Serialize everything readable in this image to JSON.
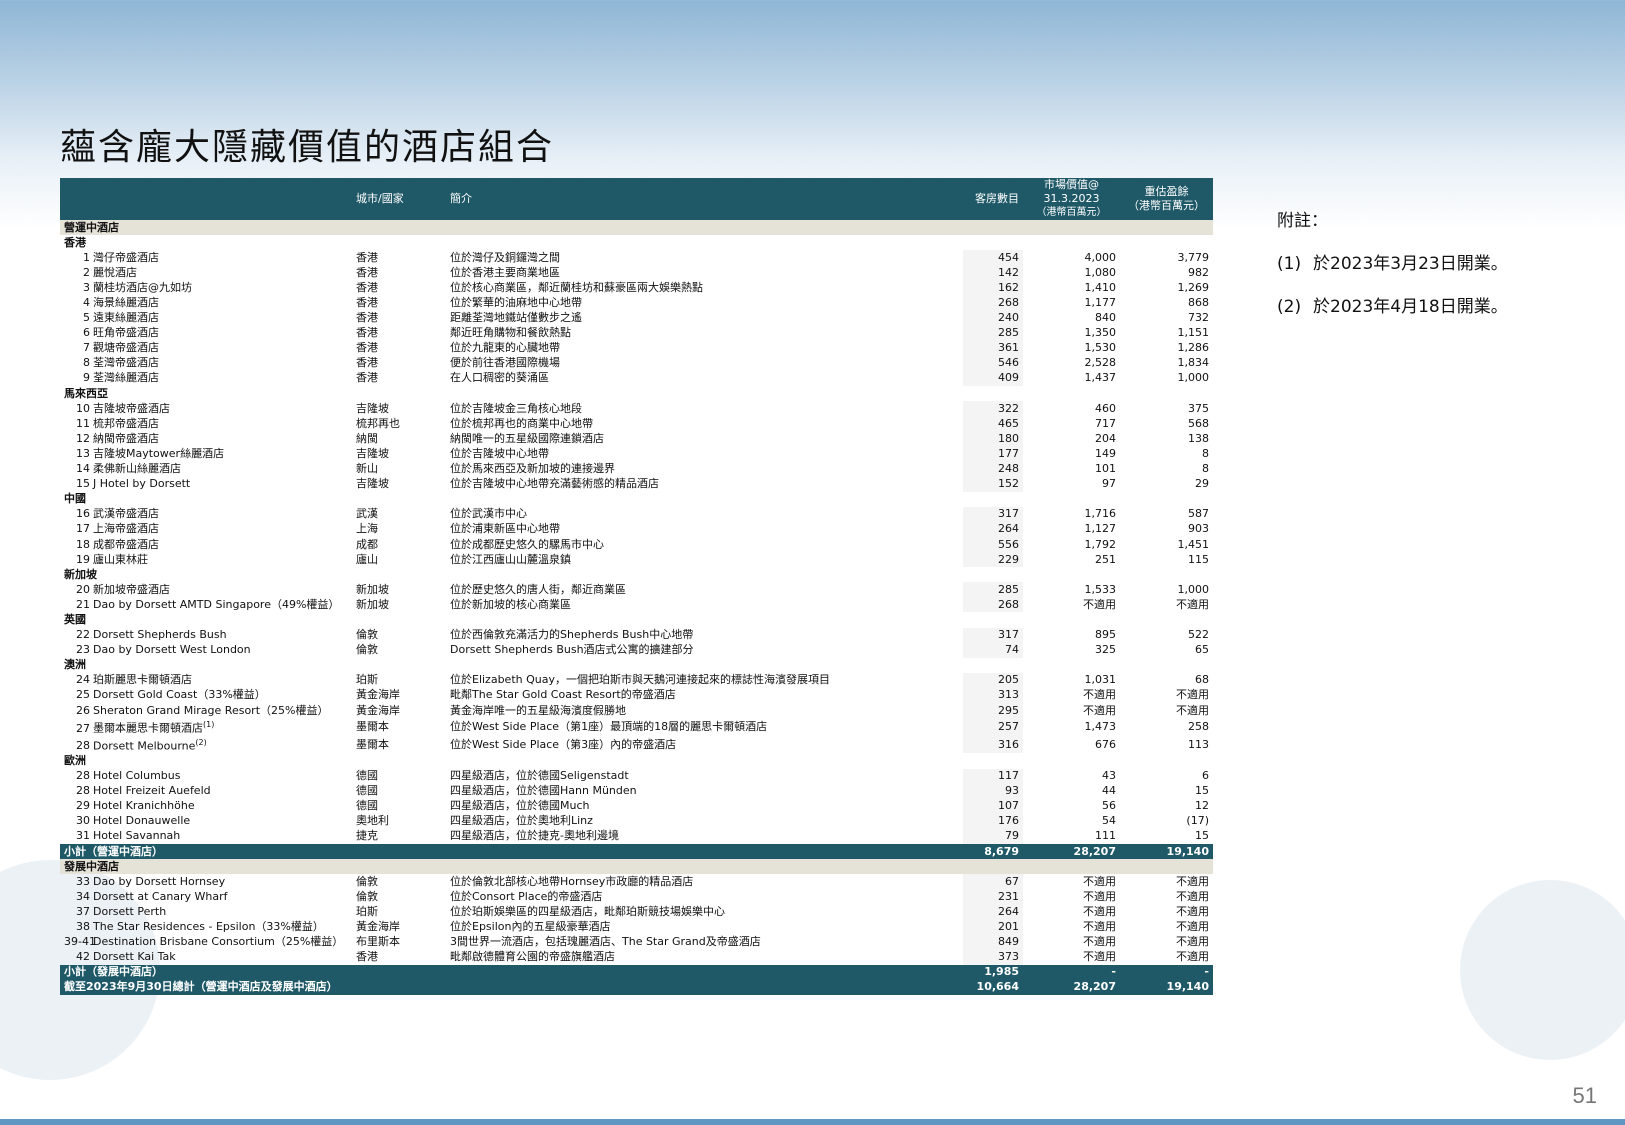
{
  "title": "蘊含龐大隱藏價值的酒店組合",
  "headers": {
    "city": "城市/國家",
    "desc": "簡介",
    "rooms": "客房數目",
    "value_line1": "市場價值@",
    "value_line2": "31.3.2023",
    "value_line3": "（港幣百萬元）",
    "surplus_line1": "重估盈餘",
    "surplus_line2": "（港幣百萬元）"
  },
  "sections": [
    {
      "label": "營運中酒店",
      "groups": [
        {
          "label": "香港",
          "rows": [
            {
              "no": "1",
              "name": "灣仔帝盛酒店",
              "city": "香港",
              "desc": "位於灣仔及銅鑼灣之間",
              "rooms": "454",
              "value": "4,000",
              "surplus": "3,779"
            },
            {
              "no": "2",
              "name": "麗悅酒店",
              "city": "香港",
              "desc": "位於香港主要商業地區",
              "rooms": "142",
              "value": "1,080",
              "surplus": "982"
            },
            {
              "no": "3",
              "name": "蘭桂坊酒店@九如坊",
              "city": "香港",
              "desc": "位於核心商業區，鄰近蘭桂坊和蘇豪區兩大娛樂熱點",
              "rooms": "162",
              "value": "1,410",
              "surplus": "1,269"
            },
            {
              "no": "4",
              "name": "海景絲麗酒店",
              "city": "香港",
              "desc": "位於繁華的油麻地中心地帶",
              "rooms": "268",
              "value": "1,177",
              "surplus": "868"
            },
            {
              "no": "5",
              "name": "遠東絲麗酒店",
              "city": "香港",
              "desc": "距離荃灣地鐵站僅數步之遙",
              "rooms": "240",
              "value": "840",
              "surplus": "732"
            },
            {
              "no": "6",
              "name": "旺角帝盛酒店",
              "city": "香港",
              "desc": "鄰近旺角購物和餐飲熱點",
              "rooms": "285",
              "value": "1,350",
              "surplus": "1,151"
            },
            {
              "no": "7",
              "name": "觀塘帝盛酒店",
              "city": "香港",
              "desc": "位於九龍東的心臟地帶",
              "rooms": "361",
              "value": "1,530",
              "surplus": "1,286"
            },
            {
              "no": "8",
              "name": "荃灣帝盛酒店",
              "city": "香港",
              "desc": "便於前往香港國際機場",
              "rooms": "546",
              "value": "2,528",
              "surplus": "1,834"
            },
            {
              "no": "9",
              "name": "荃灣絲麗酒店",
              "city": "香港",
              "desc": "在人口稠密的葵涌區",
              "rooms": "409",
              "value": "1,437",
              "surplus": "1,000"
            }
          ]
        },
        {
          "label": "馬來西亞",
          "rows": [
            {
              "no": "10",
              "name": "吉隆坡帝盛酒店",
              "city": "吉隆坡",
              "desc": "位於吉隆坡金三角核心地段",
              "rooms": "322",
              "value": "460",
              "surplus": "375"
            },
            {
              "no": "11",
              "name": "梳邦帝盛酒店",
              "city": "梳邦再也",
              "desc": "位於梳邦再也的商業中心地帶",
              "rooms": "465",
              "value": "717",
              "surplus": "568"
            },
            {
              "no": "12",
              "name": "納閩帝盛酒店",
              "city": "納閩",
              "desc": "納閩唯一的五星級國際連鎖酒店",
              "rooms": "180",
              "value": "204",
              "surplus": "138"
            },
            {
              "no": "13",
              "name": "吉隆坡Maytower絲麗酒店",
              "city": "吉隆坡",
              "desc": "位於吉隆坡中心地帶",
              "rooms": "177",
              "value": "149",
              "surplus": "8"
            },
            {
              "no": "14",
              "name": "柔佛新山絲麗酒店",
              "city": "新山",
              "desc": "位於馬來西亞及新加坡的連接邊界",
              "rooms": "248",
              "value": "101",
              "surplus": "8"
            },
            {
              "no": "15",
              "name": "J Hotel by Dorsett",
              "city": "吉隆坡",
              "desc": "位於吉隆坡中心地帶充滿藝術感的精品酒店",
              "rooms": "152",
              "value": "97",
              "surplus": "29"
            }
          ]
        },
        {
          "label": "中國",
          "rows": [
            {
              "no": "16",
              "name": "武漢帝盛酒店",
              "city": "武漢",
              "desc": "位於武漢市中心",
              "rooms": "317",
              "value": "1,716",
              "surplus": "587"
            },
            {
              "no": "17",
              "name": "上海帝盛酒店",
              "city": "上海",
              "desc": "位於浦東新區中心地帶",
              "rooms": "264",
              "value": "1,127",
              "surplus": "903"
            },
            {
              "no": "18",
              "name": "成都帝盛酒店",
              "city": "成都",
              "desc": "位於成都歷史悠久的騾馬市中心",
              "rooms": "556",
              "value": "1,792",
              "surplus": "1,451"
            },
            {
              "no": "19",
              "name": "廬山東林莊",
              "city": "廬山",
              "desc": "位於江西廬山山麓溫泉鎮",
              "rooms": "229",
              "value": "251",
              "surplus": "115"
            }
          ]
        },
        {
          "label": "新加坡",
          "rows": [
            {
              "no": "20",
              "name": "新加坡帝盛酒店",
              "city": "新加坡",
              "desc": "位於歷史悠久的唐人街，鄰近商業區",
              "rooms": "285",
              "value": "1,533",
              "surplus": "1,000"
            },
            {
              "no": "21",
              "name": "Dao by Dorsett AMTD Singapore（49%權益）",
              "city": "新加坡",
              "desc": "位於新加坡的核心商業區",
              "rooms": "268",
              "value": "不適用",
              "surplus": "不適用"
            }
          ]
        },
        {
          "label": "英國",
          "rows": [
            {
              "no": "22",
              "name": "Dorsett Shepherds Bush",
              "city": "倫敦",
              "desc": "位於西倫敦充滿活力的Shepherds Bush中心地帶",
              "rooms": "317",
              "value": "895",
              "surplus": "522"
            },
            {
              "no": "23",
              "name": "Dao by Dorsett West London",
              "city": "倫敦",
              "desc": "Dorsett Shepherds Bush酒店式公寓的擴建部分",
              "rooms": "74",
              "value": "325",
              "surplus": "65"
            }
          ]
        },
        {
          "label": "澳洲",
          "rows": [
            {
              "no": "24",
              "name": "珀斯麗思卡爾頓酒店",
              "city": "珀斯",
              "desc": "位於Elizabeth Quay，一個把珀斯市與天鵝河連接起來的標誌性海濱發展項目",
              "rooms": "205",
              "value": "1,031",
              "surplus": "68"
            },
            {
              "no": "25",
              "name": "Dorsett Gold Coast（33%權益）",
              "city": "黃金海岸",
              "desc": "毗鄰The Star Gold Coast Resort的帝盛酒店",
              "rooms": "313",
              "value": "不適用",
              "surplus": "不適用"
            },
            {
              "no": "26",
              "name": "Sheraton Grand Mirage Resort（25%權益）",
              "city": "黃金海岸",
              "desc": "黃金海岸唯一的五星級海濱度假勝地",
              "rooms": "295",
              "value": "不適用",
              "surplus": "不適用"
            },
            {
              "no": "27",
              "name": "墨爾本麗思卡爾頓酒店",
              "sup": "(1)",
              "city": "墨爾本",
              "desc": "位於West Side Place（第1座）最頂端的18層的麗思卡爾頓酒店",
              "rooms": "257",
              "value": "1,473",
              "surplus": "258"
            },
            {
              "no": "28",
              "name": "Dorsett Melbourne",
              "sup": "(2)",
              "city": "墨爾本",
              "desc": "位於West Side Place（第3座）內的帝盛酒店",
              "rooms": "316",
              "value": "676",
              "surplus": "113"
            }
          ]
        },
        {
          "label": "歐洲",
          "rows": [
            {
              "no": "28",
              "name": "Hotel Columbus",
              "city": "德國",
              "desc": "四星級酒店，位於德國Seligenstadt",
              "rooms": "117",
              "value": "43",
              "surplus": "6"
            },
            {
              "no": "28",
              "name": "Hotel Freizeit Auefeld",
              "city": "德國",
              "desc": "四星級酒店，位於德國Hann Münden",
              "rooms": "93",
              "value": "44",
              "surplus": "15"
            },
            {
              "no": "29",
              "name": "Hotel Kranichhöhe",
              "city": "德國",
              "desc": "四星級酒店，位於德國Much",
              "rooms": "107",
              "value": "56",
              "surplus": "12"
            },
            {
              "no": "30",
              "name": "Hotel Donauwelle",
              "city": "奧地利",
              "desc": "四星級酒店，位於奧地利Linz",
              "rooms": "176",
              "value": "54",
              "surplus": "(17)"
            },
            {
              "no": "31",
              "name": "Hotel Savannah",
              "city": "捷克",
              "desc": "四星級酒店，位於捷克-奧地利邊境",
              "rooms": "79",
              "value": "111",
              "surplus": "15"
            }
          ]
        }
      ],
      "subtotal": {
        "label": "小計（營運中酒店）",
        "rooms": "8,679",
        "value": "28,207",
        "surplus": "19,140"
      }
    },
    {
      "label": "發展中酒店",
      "groups": [
        {
          "label": "",
          "rows": [
            {
              "no": "33",
              "name": "Dao by Dorsett Hornsey",
              "city": "倫敦",
              "desc": "位於倫敦北部核心地帶Hornsey市政廳的精品酒店",
              "rooms": "67",
              "value": "不適用",
              "surplus": "不適用"
            },
            {
              "no": "34",
              "name": "Dorsett at Canary Wharf",
              "city": "倫敦",
              "desc": "位於Consort Place的帝盛酒店",
              "rooms": "231",
              "value": "不適用",
              "surplus": "不適用"
            },
            {
              "no": "37",
              "name": "Dorsett Perth",
              "city": "珀斯",
              "desc": "位於珀斯娛樂區的四星級酒店，毗鄰珀斯競技場娛樂中心",
              "rooms": "264",
              "value": "不適用",
              "surplus": "不適用"
            },
            {
              "no": "38",
              "name": "The Star Residences - Epsilon（33%權益）",
              "city": "黃金海岸",
              "desc": "位於Epsilon內的五星級豪華酒店",
              "rooms": "201",
              "value": "不適用",
              "surplus": "不適用"
            },
            {
              "no": "39-41",
              "name": "Destination Brisbane Consortium（25%權益）",
              "city": "布里斯本",
              "desc": "3間世界一流酒店，包括瑰麗酒店、The Star Grand及帝盛酒店",
              "rooms": "849",
              "value": "不適用",
              "surplus": "不適用"
            },
            {
              "no": "42",
              "name": "Dorsett Kai Tak",
              "city": "香港",
              "desc": "毗鄰啟德體育公園的帝盛旗艦酒店",
              "rooms": "373",
              "value": "不適用",
              "surplus": "不適用"
            }
          ]
        }
      ],
      "subtotal": {
        "label": "小計（發展中酒店）",
        "rooms": "1,985",
        "value": "-",
        "surplus": "-"
      }
    }
  ],
  "grand_total": {
    "label": "截至2023年9月30日總計（營運中酒店及發展中酒店）",
    "rooms": "10,664",
    "value": "28,207",
    "surplus": "19,140"
  },
  "notes": {
    "heading": "附註：",
    "items": [
      {
        "num": "(1)",
        "text": "於2023年3月23日開業。"
      },
      {
        "num": "(2)",
        "text": "於2023年4月18日開業。"
      }
    ]
  },
  "page_number": "51",
  "colors": {
    "header_bg": "#1f5968",
    "section_bg": "#e5e2d8",
    "bottom_bar": "#5f97c2"
  }
}
